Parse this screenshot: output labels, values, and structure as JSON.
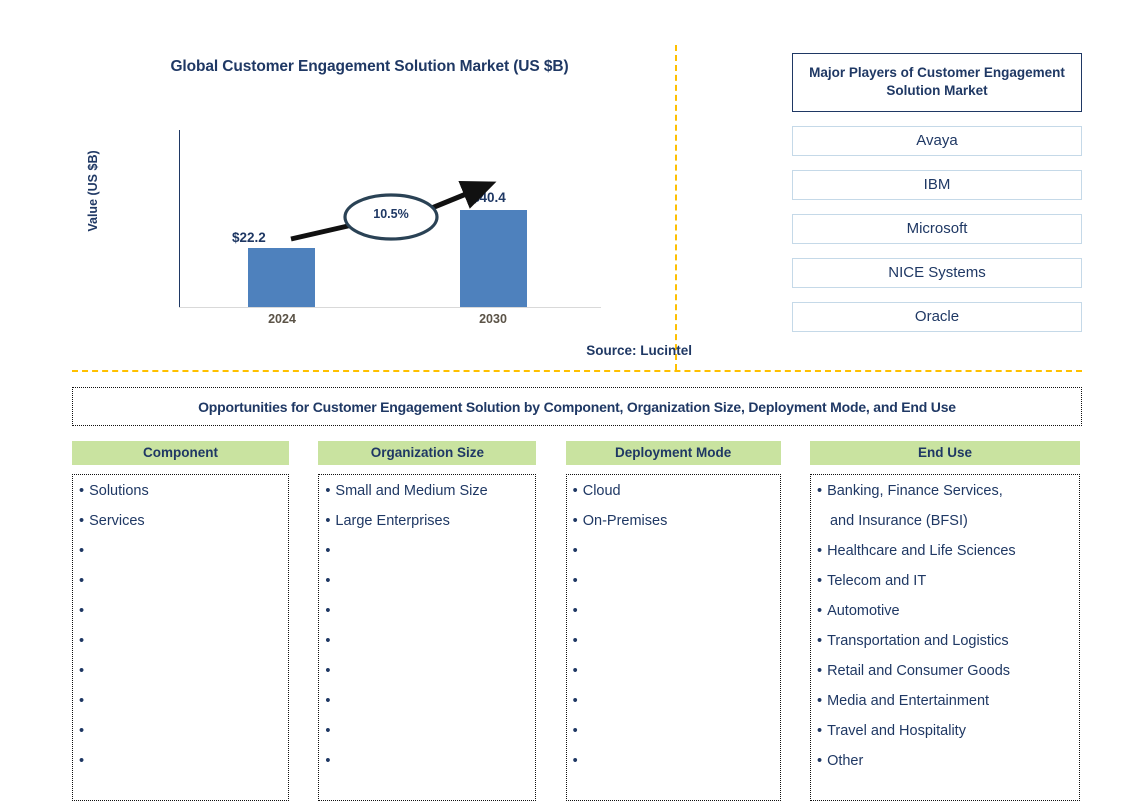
{
  "chart_data": {
    "type": "bar",
    "title": "Global Customer Engagement Solution Market (US $B)",
    "xlabel": "",
    "ylabel": "Value (US $B)",
    "categories": [
      "2024",
      "2030"
    ],
    "values": [
      22.2,
      40.4
    ],
    "value_labels": [
      "$22.2",
      "$40.4"
    ],
    "ylim": [
      0,
      46
    ],
    "grid": false,
    "legend": null,
    "annotations": [
      {
        "text": "10.5%",
        "kind": "cagr-ellipse-callout"
      }
    ],
    "bar_color": "#4E81BD",
    "source": "Source: Lucintel"
  },
  "chart_panel": {
    "title": "Global Customer Engagement Solution Market (US $B)",
    "y_axis_label": "Value (US $B)",
    "cagr_label": "10.5%",
    "bars": [
      {
        "category": "2024",
        "value_label": "$22.2"
      },
      {
        "category": "2030",
        "value_label": "$40.4"
      }
    ],
    "source": "Source: Lucintel"
  },
  "players_panel": {
    "header": "Major Players of Customer Engagement Solution Market",
    "players": [
      "Avaya",
      "IBM",
      "Microsoft",
      "NICE Systems",
      "Oracle"
    ]
  },
  "opportunities": {
    "title": "Opportunities for Customer Engagement Solution by Component, Organization Size, Deployment Mode, and End Use",
    "columns": [
      {
        "header": "Component",
        "items": [
          "Solutions",
          "Services"
        ],
        "empty_bullets": 8
      },
      {
        "header": "Organization Size",
        "items": [
          "Small and Medium Size",
          "Large Enterprises"
        ],
        "empty_bullets": 8
      },
      {
        "header": "Deployment Mode",
        "items": [
          "Cloud",
          "On-Premises"
        ],
        "empty_bullets": 8
      },
      {
        "header": "End Use",
        "items": [
          "Banking, Finance Services,",
          "and Insurance (BFSI)",
          "Healthcare and Life Sciences",
          "Telecom and IT",
          "Automotive",
          "Transportation and Logistics",
          "Retail and Consumer Goods",
          "Media and Entertainment",
          "Travel and Hospitality",
          "Other"
        ],
        "continuation_indexes": [
          1
        ],
        "empty_bullets": 0
      }
    ]
  },
  "colors": {
    "navy": "#1F3864",
    "bar_blue": "#4E81BD",
    "header_green": "#C9E3A0",
    "divider_gold": "#FFC000",
    "player_border": "#C5D9E8",
    "tick_label": "#5B5347"
  }
}
